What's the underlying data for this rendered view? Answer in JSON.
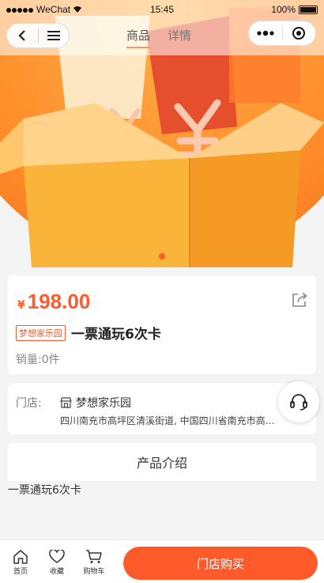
{
  "status_bar": {
    "carrier": "WeChat",
    "time": "15:45",
    "battery": "100%"
  },
  "nav": {
    "tabs": [
      {
        "label": "商品",
        "active": true
      },
      {
        "label": "详情",
        "active": false
      }
    ]
  },
  "product": {
    "currency_symbol": "¥",
    "price": "198.00",
    "tag": "梦想家乐园",
    "title": "一票通玩6次卡",
    "sales": "销量:0件"
  },
  "store": {
    "label": "门店:",
    "name": "梦想家乐园",
    "address": "四川南充市高坪区清溪街道, 中国四川省南充市高坪区"
  },
  "intro": {
    "heading": "产品介绍",
    "body": "一票通玩6次卡"
  },
  "bottom_bar": {
    "items": [
      {
        "label": "首页",
        "icon": "home-icon"
      },
      {
        "label": "收藏",
        "icon": "heart-icon"
      },
      {
        "label": "购物车",
        "icon": "cart-icon"
      }
    ],
    "buy_button": "门店购买"
  },
  "colors": {
    "accent": "#ff5a2a",
    "tab_underline": "#f09a5a"
  },
  "carousel": {
    "pages": 1,
    "current": 1
  }
}
